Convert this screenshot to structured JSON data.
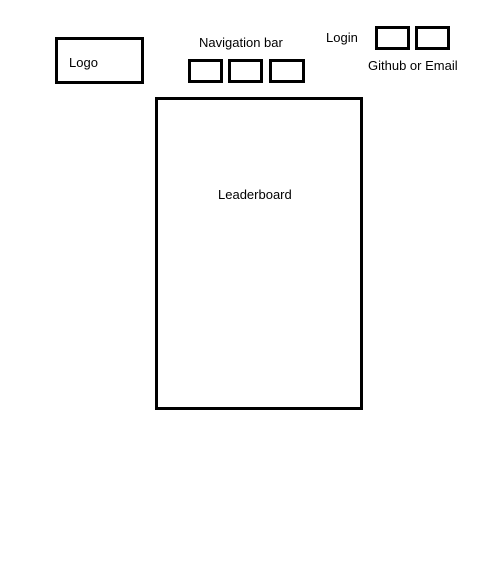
{
  "logo": {
    "label": "Logo"
  },
  "navigation": {
    "title": "Navigation bar",
    "items": [
      "",
      "",
      ""
    ]
  },
  "login": {
    "label": "Login",
    "caption": "Github or Email",
    "options": [
      "",
      ""
    ]
  },
  "leaderboard": {
    "label": "Leaderboard"
  }
}
